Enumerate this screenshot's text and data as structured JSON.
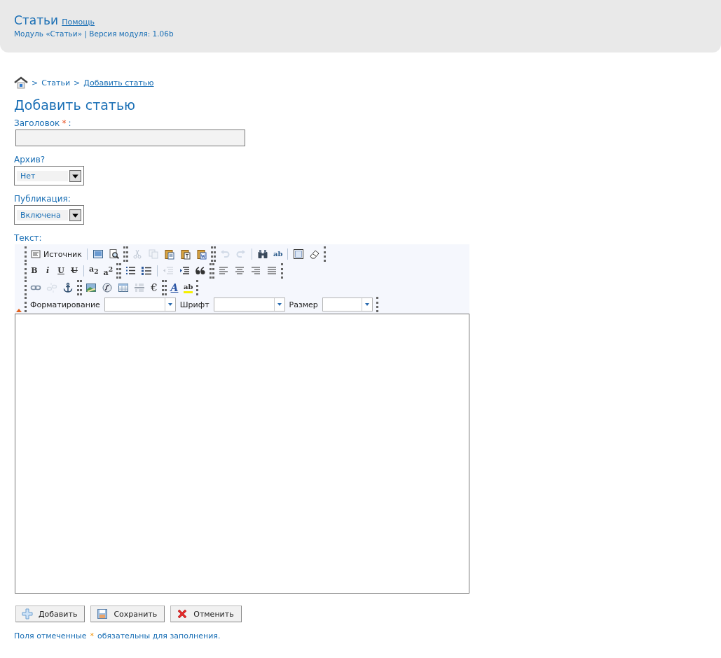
{
  "header": {
    "title": "Статьи",
    "help_link": "Помощь",
    "subtitle": "Модуль «Статьи» | Версия модуля: 1.06b"
  },
  "breadcrumb": {
    "separator_1": ">",
    "item_1": "Статьи",
    "separator_2": ">",
    "item_2": "Добавить статью"
  },
  "page_title": "Добавить статью",
  "form": {
    "title_label": "Заголовок",
    "required_mark": "*",
    "title_label_colon": ":",
    "archive_label": "Архив?",
    "archive_value": "Нет",
    "publication_label": "Публикация:",
    "publication_value": "Включена",
    "text_label": "Текст:"
  },
  "toolbar": {
    "rows": [
      [
        [
          {
            "kind": "source",
            "label": "Источник",
            "disabled": false
          },
          {
            "kind": "sep"
          },
          {
            "kind": "monitor",
            "disabled": false
          },
          {
            "kind": "preview",
            "disabled": false
          }
        ],
        [
          {
            "kind": "cut",
            "disabled": true
          },
          {
            "kind": "copy",
            "disabled": true
          },
          {
            "kind": "paste",
            "disabled": false
          },
          {
            "kind": "paste-text",
            "disabled": false
          },
          {
            "kind": "paste-word",
            "disabled": false
          }
        ],
        [
          {
            "kind": "undo",
            "disabled": true
          },
          {
            "kind": "redo",
            "disabled": true
          },
          {
            "kind": "sep"
          },
          {
            "kind": "find",
            "disabled": false
          },
          {
            "kind": "spell",
            "glyph": "ab",
            "disabled": false
          },
          {
            "kind": "sep"
          },
          {
            "kind": "select-all",
            "disabled": false
          },
          {
            "kind": "eraser",
            "disabled": false
          }
        ]
      ],
      [
        [
          {
            "kind": "bold",
            "glyph": "B",
            "disabled": false
          },
          {
            "kind": "italic",
            "glyph": "i",
            "disabled": false
          },
          {
            "kind": "underline",
            "glyph": "U",
            "disabled": false
          },
          {
            "kind": "strike",
            "glyph": "U",
            "disabled": false
          },
          {
            "kind": "sep"
          },
          {
            "kind": "sub",
            "glyph": "a$_{2}$",
            "disabled": false
          },
          {
            "kind": "sup",
            "glyph": "a$^{2}$",
            "disabled": false
          }
        ],
        [
          {
            "kind": "ol",
            "disabled": false
          },
          {
            "kind": "ul",
            "disabled": false
          },
          {
            "kind": "sep"
          },
          {
            "kind": "outdent",
            "disabled": true
          },
          {
            "kind": "indent",
            "disabled": false
          },
          {
            "kind": "quote",
            "disabled": false
          }
        ],
        [
          {
            "kind": "align-left",
            "disabled": false
          },
          {
            "kind": "align-center",
            "disabled": false
          },
          {
            "kind": "align-right",
            "disabled": false
          },
          {
            "kind": "justify",
            "disabled": false
          }
        ]
      ],
      [
        [
          {
            "kind": "link",
            "disabled": false
          },
          {
            "kind": "unlink",
            "disabled": true
          },
          {
            "kind": "anchor",
            "disabled": false
          }
        ],
        [
          {
            "kind": "image",
            "disabled": false
          },
          {
            "kind": "flash",
            "disabled": false
          },
          {
            "kind": "table",
            "disabled": false
          },
          {
            "kind": "hr",
            "disabled": false
          },
          {
            "kind": "euro",
            "glyph": "€",
            "disabled": false
          }
        ],
        [
          {
            "kind": "text-color",
            "glyph": "A",
            "disabled": false
          },
          {
            "kind": "bg-color",
            "glyph": "ab",
            "disabled": false
          }
        ]
      ]
    ],
    "combos": [
      {
        "label": "Форматирование"
      },
      {
        "label": "Шрифт"
      },
      {
        "label": "Размер"
      }
    ]
  },
  "buttons": [
    {
      "kind": "add",
      "label": "Добавить"
    },
    {
      "kind": "save",
      "label": "Сохранить"
    },
    {
      "kind": "cancel",
      "label": "Отменить"
    }
  ],
  "footer_note": {
    "before": "Поля отмеченные",
    "mark": "*",
    "after": "обязательны для заполнения."
  }
}
